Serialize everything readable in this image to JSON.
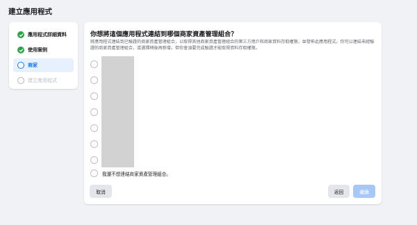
{
  "page": {
    "title": "建立應用程式"
  },
  "sidebar": {
    "steps": [
      {
        "label": "應用程式詳細資料",
        "state": "done",
        "icon": "check-icon"
      },
      {
        "label": "使用案例",
        "state": "done",
        "icon": "check-icon"
      },
      {
        "label": "商家",
        "state": "current",
        "icon": "circle-icon"
      },
      {
        "label": "建立應用程式",
        "state": "disabled",
        "icon": "circle-icon"
      }
    ]
  },
  "main": {
    "question": "你想將這個應用程式連結到哪個商家資產管理組合？",
    "description": "將應用程式連結到已驗證的商家資產管理組合，以取得其他商家資產管理組合的第三方用戶和商家資料存取權限，並發佈此應用程式。你可以連結未經驗證的商家資產管理組合，或選擇稍後再新增。但你會須要完成驗證才能取得資料存取權限。",
    "none_option": "我還不想連結商家資產管理組合。"
  },
  "buttons": {
    "cancel": "取消",
    "back": "返回",
    "next": "繼續"
  },
  "colors": {
    "accent": "#1877f2",
    "success": "#31a24c",
    "disabled_button": "#a7c7f7",
    "background": "#f0f2f5"
  }
}
